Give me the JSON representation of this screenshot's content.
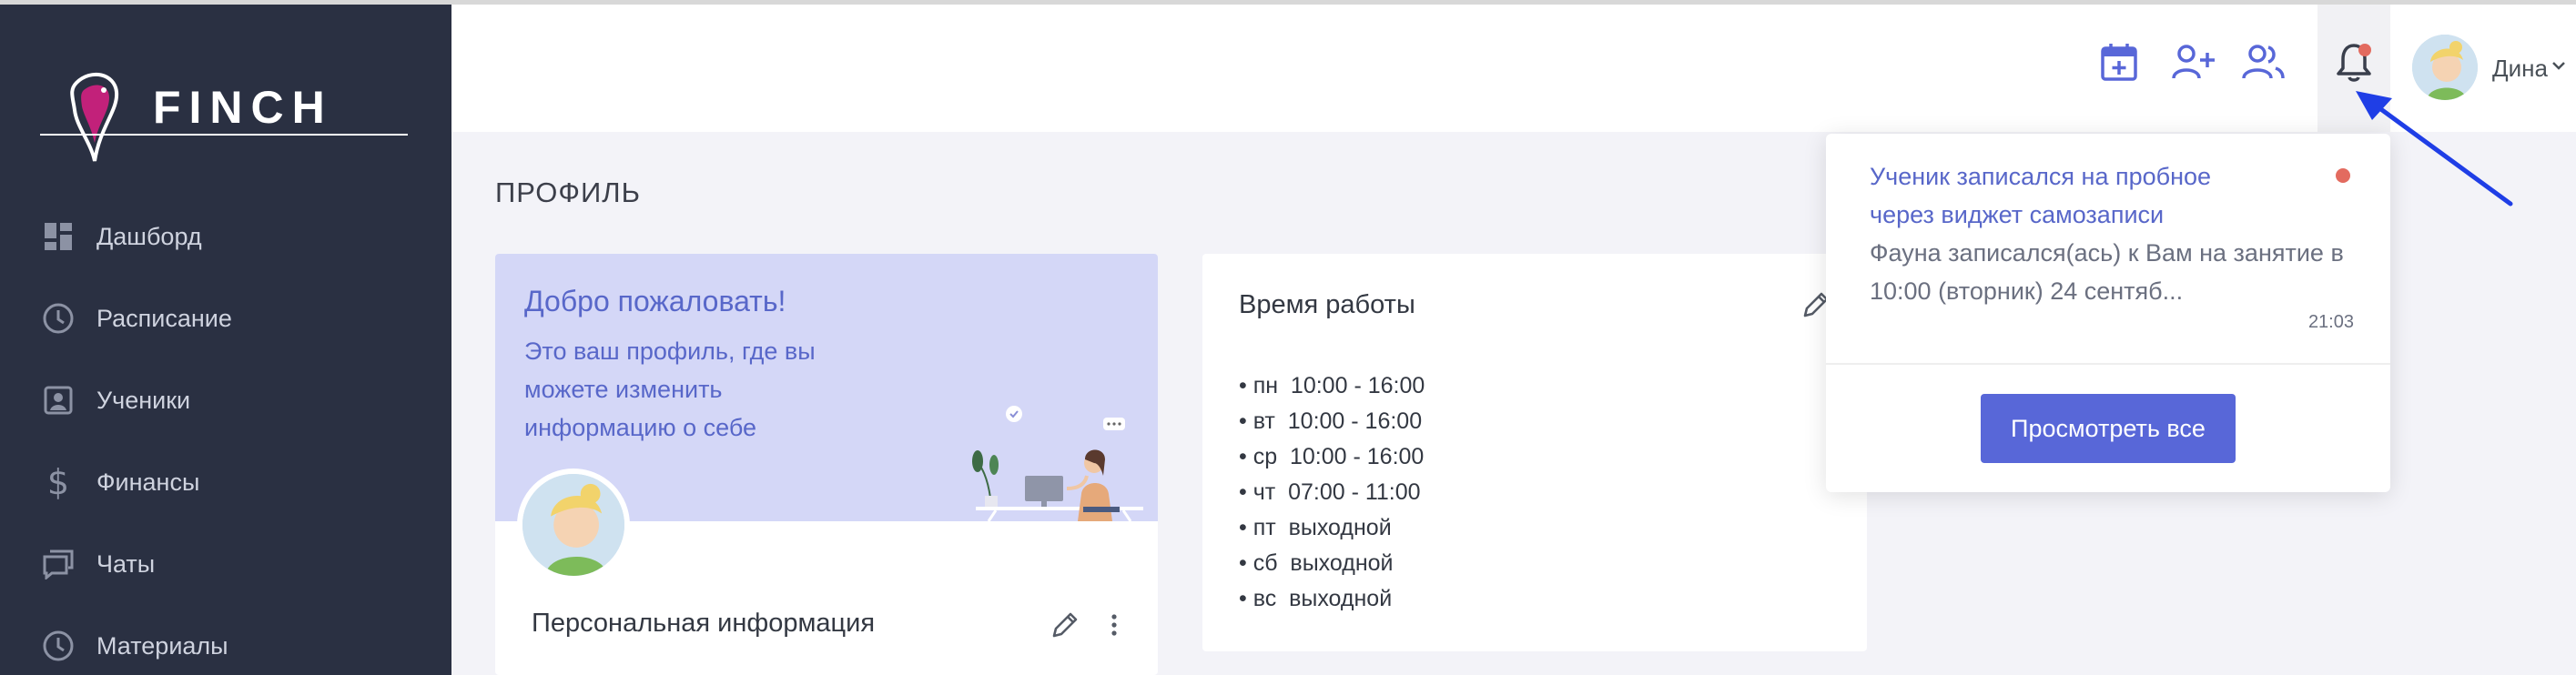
{
  "brand": {
    "name": "FINCH"
  },
  "sidebar": {
    "items": [
      {
        "label": "Дашборд",
        "icon": "dashboard-icon"
      },
      {
        "label": "Расписание",
        "icon": "clock-icon"
      },
      {
        "label": "Ученики",
        "icon": "student-icon"
      },
      {
        "label": "Финансы",
        "icon": "dollar-icon"
      },
      {
        "label": "Чаты",
        "icon": "chat-icon"
      },
      {
        "label": "Материалы",
        "icon": "clock-icon"
      }
    ]
  },
  "header": {
    "icons": [
      "calendar-add-icon",
      "user-add-icon",
      "users-icon",
      "bell-icon"
    ],
    "user_name": "Дина"
  },
  "page": {
    "title": "ПРОФИЛЬ"
  },
  "profile_card": {
    "welcome_title": "Добро пожаловать!",
    "welcome_text": "Это ваш профиль, где вы можете изменить информацию о себе",
    "personal_title": "Персональная информация"
  },
  "work_card": {
    "title": "Время работы",
    "schedule": [
      "• пн  10:00 - 16:00",
      "• вт  10:00 - 16:00",
      "• ср  10:00 - 16:00",
      "• чт  07:00 - 11:00",
      "• пт  выходной",
      "• сб  выходной",
      "• вс  выходной"
    ]
  },
  "notification": {
    "title": "Ученик записался на пробное через виджет самозаписи",
    "text": "Фауна записался(ась) к Вам на занятие в 10:00 (вторник) 24 сентяб...",
    "time": "21:03",
    "view_all": "Просмотреть все"
  },
  "colors": {
    "sidebar_bg": "#2a3042",
    "accent": "#5867d8",
    "accent_text": "#5867c9",
    "welcome_bg": "#d4d7f7",
    "unread_dot": "#e36b5f",
    "annotation_arrow": "#1f3ee6"
  }
}
